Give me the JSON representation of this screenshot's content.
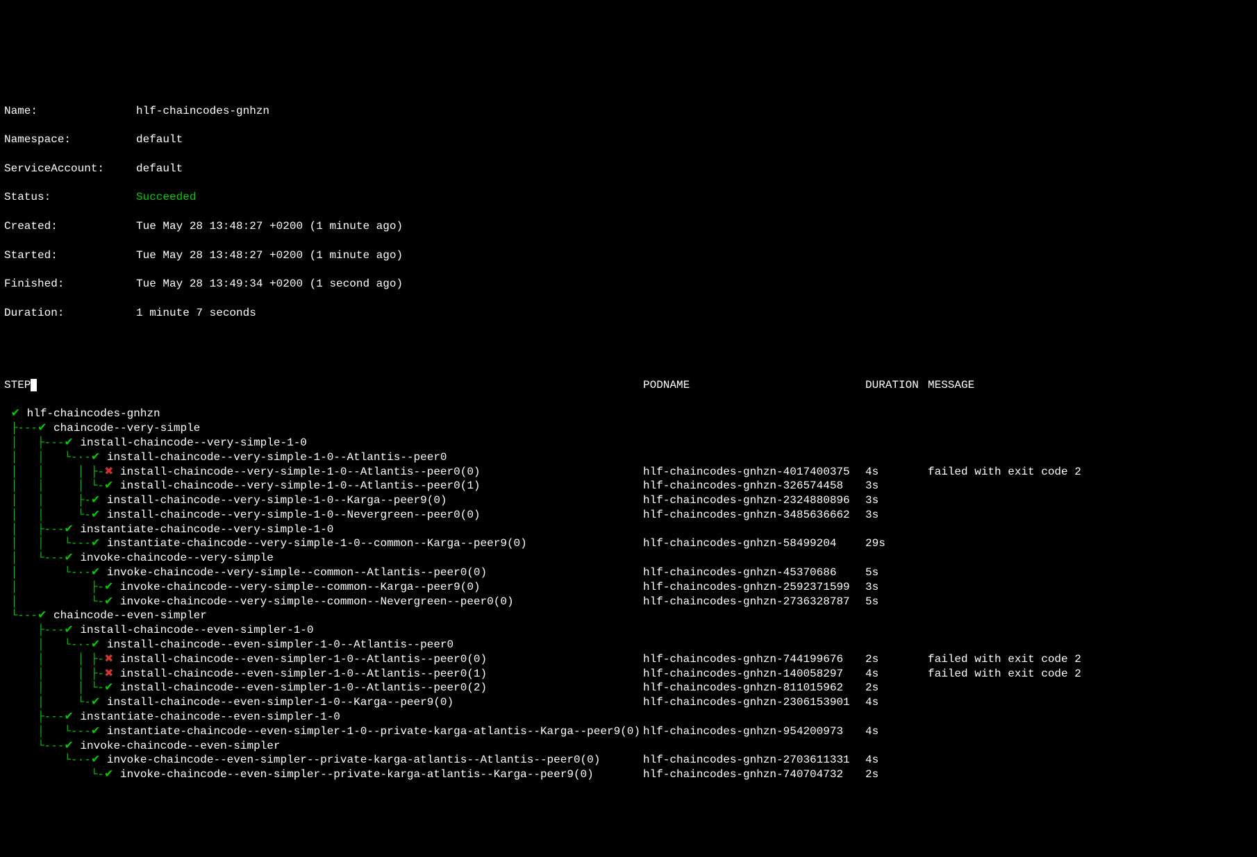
{
  "meta": {
    "name_label": "Name:",
    "name": "hlf-chaincodes-gnhzn",
    "ns_label": "Namespace:",
    "ns": "default",
    "sa_label": "ServiceAccount:",
    "sa": "default",
    "status_label": "Status:",
    "status": "Succeeded",
    "created_label": "Created:",
    "created": "Tue May 28 13:48:27 +0200 (1 minute ago)",
    "started_label": "Started:",
    "started": "Tue May 28 13:48:27 +0200 (1 minute ago)",
    "finished_label": "Finished:",
    "finished": "Tue May 28 13:49:34 +0200 (1 second ago)",
    "duration_label": "Duration:",
    "duration": "1 minute 7 seconds"
  },
  "header": {
    "step": "STEP",
    "podname": "PODNAME",
    "duration": "DURATION",
    "message": "MESSAGE"
  },
  "rows": [
    {
      "prefix_a": " ",
      "icon": "✔",
      "icon_c": "green",
      "prefix_b": " ",
      "step": "hlf-chaincodes-gnhzn",
      "pod": "",
      "dur": "",
      "msg": ""
    },
    {
      "prefix_a": " ├---",
      "icon": "✔",
      "icon_c": "green",
      "prefix_b": " ",
      "step": "chaincode--very-simple",
      "pod": "",
      "dur": "",
      "msg": ""
    },
    {
      "prefix_a": " │   ├---",
      "icon": "✔",
      "icon_c": "green",
      "prefix_b": " ",
      "step": "install-chaincode--very-simple-1-0",
      "pod": "",
      "dur": "",
      "msg": ""
    },
    {
      "prefix_a": " │   │   └-·-",
      "icon": "✔",
      "icon_c": "green",
      "prefix_b": " ",
      "step": "install-chaincode--very-simple-1-0--Atlantis--peer0",
      "pod": "",
      "dur": "",
      "msg": ""
    },
    {
      "prefix_a": " │   │     │ ├-",
      "icon": "✖",
      "icon_c": "red",
      "prefix_b": " ",
      "step": "install-chaincode--very-simple-1-0--Atlantis--peer0(0)",
      "pod": "hlf-chaincodes-gnhzn-4017400375",
      "dur": "4s",
      "msg": "failed with exit code 2"
    },
    {
      "prefix_a": " │   │     │ └-",
      "icon": "✔",
      "icon_c": "green",
      "prefix_b": " ",
      "step": "install-chaincode--very-simple-1-0--Atlantis--peer0(1)",
      "pod": "hlf-chaincodes-gnhzn-326574458",
      "dur": "3s",
      "msg": ""
    },
    {
      "prefix_a": " │   │     ├-",
      "icon": "✔",
      "icon_c": "green",
      "prefix_b": " ",
      "step": "install-chaincode--very-simple-1-0--Karga--peer9(0)",
      "pod": "hlf-chaincodes-gnhzn-2324880896",
      "dur": "3s",
      "msg": ""
    },
    {
      "prefix_a": " │   │     └-",
      "icon": "✔",
      "icon_c": "green",
      "prefix_b": " ",
      "step": "install-chaincode--very-simple-1-0--Nevergreen--peer0(0)",
      "pod": "hlf-chaincodes-gnhzn-3485636662",
      "dur": "3s",
      "msg": ""
    },
    {
      "prefix_a": " │   ├---",
      "icon": "✔",
      "icon_c": "green",
      "prefix_b": " ",
      "step": "instantiate-chaincode--very-simple-1-0",
      "pod": "",
      "dur": "",
      "msg": ""
    },
    {
      "prefix_a": " │   │   └---",
      "icon": "✔",
      "icon_c": "green",
      "prefix_b": " ",
      "step": "instantiate-chaincode--very-simple-1-0--common--Karga--peer9(0)",
      "pod": "hlf-chaincodes-gnhzn-58499204",
      "dur": "29s",
      "msg": ""
    },
    {
      "prefix_a": " │   └---",
      "icon": "✔",
      "icon_c": "green",
      "prefix_b": " ",
      "step": "invoke-chaincode--very-simple",
      "pod": "",
      "dur": "",
      "msg": ""
    },
    {
      "prefix_a": " │       └-·-",
      "icon": "✔",
      "icon_c": "green",
      "prefix_b": " ",
      "step": "invoke-chaincode--very-simple--common--Atlantis--peer0(0)",
      "pod": "hlf-chaincodes-gnhzn-45370686",
      "dur": "5s",
      "msg": ""
    },
    {
      "prefix_a": " │           ├-",
      "icon": "✔",
      "icon_c": "green",
      "prefix_b": " ",
      "step": "invoke-chaincode--very-simple--common--Karga--peer9(0)",
      "pod": "hlf-chaincodes-gnhzn-2592371599",
      "dur": "3s",
      "msg": ""
    },
    {
      "prefix_a": " │           └-",
      "icon": "✔",
      "icon_c": "green",
      "prefix_b": " ",
      "step": "invoke-chaincode--very-simple--common--Nevergreen--peer0(0)",
      "pod": "hlf-chaincodes-gnhzn-2736328787",
      "dur": "5s",
      "msg": ""
    },
    {
      "prefix_a": " └---",
      "icon": "✔",
      "icon_c": "green",
      "prefix_b": " ",
      "step": "chaincode--even-simpler",
      "pod": "",
      "dur": "",
      "msg": ""
    },
    {
      "prefix_a": "     ├---",
      "icon": "✔",
      "icon_c": "green",
      "prefix_b": " ",
      "step": "install-chaincode--even-simpler-1-0",
      "pod": "",
      "dur": "",
      "msg": ""
    },
    {
      "prefix_a": "     │   └-·-",
      "icon": "✔",
      "icon_c": "green",
      "prefix_b": " ",
      "step": "install-chaincode--even-simpler-1-0--Atlantis--peer0",
      "pod": "",
      "dur": "",
      "msg": ""
    },
    {
      "prefix_a": "     │     │ ├-",
      "icon": "✖",
      "icon_c": "red",
      "prefix_b": " ",
      "step": "install-chaincode--even-simpler-1-0--Atlantis--peer0(0)",
      "pod": "hlf-chaincodes-gnhzn-744199676",
      "dur": "2s",
      "msg": "failed with exit code 2"
    },
    {
      "prefix_a": "     │     │ ├-",
      "icon": "✖",
      "icon_c": "red",
      "prefix_b": " ",
      "step": "install-chaincode--even-simpler-1-0--Atlantis--peer0(1)",
      "pod": "hlf-chaincodes-gnhzn-140058297",
      "dur": "4s",
      "msg": "failed with exit code 2"
    },
    {
      "prefix_a": "     │     │ └-",
      "icon": "✔",
      "icon_c": "green",
      "prefix_b": " ",
      "step": "install-chaincode--even-simpler-1-0--Atlantis--peer0(2)",
      "pod": "hlf-chaincodes-gnhzn-811015962",
      "dur": "2s",
      "msg": ""
    },
    {
      "prefix_a": "     │     └-",
      "icon": "✔",
      "icon_c": "green",
      "prefix_b": " ",
      "step": "install-chaincode--even-simpler-1-0--Karga--peer9(0)",
      "pod": "hlf-chaincodes-gnhzn-2306153901",
      "dur": "4s",
      "msg": ""
    },
    {
      "prefix_a": "     ├---",
      "icon": "✔",
      "icon_c": "green",
      "prefix_b": " ",
      "step": "instantiate-chaincode--even-simpler-1-0",
      "pod": "",
      "dur": "",
      "msg": ""
    },
    {
      "prefix_a": "     │   └---",
      "icon": "✔",
      "icon_c": "green",
      "prefix_b": " ",
      "step": "instantiate-chaincode--even-simpler-1-0--private-karga-atlantis--Karga--peer9(0)",
      "pod": "hlf-chaincodes-gnhzn-954200973",
      "dur": "4s",
      "msg": ""
    },
    {
      "prefix_a": "     └---",
      "icon": "✔",
      "icon_c": "green",
      "prefix_b": " ",
      "step": "invoke-chaincode--even-simpler",
      "pod": "",
      "dur": "",
      "msg": ""
    },
    {
      "prefix_a": "         └-·-",
      "icon": "✔",
      "icon_c": "green",
      "prefix_b": " ",
      "step": "invoke-chaincode--even-simpler--private-karga-atlantis--Atlantis--peer0(0)",
      "pod": "hlf-chaincodes-gnhzn-2703611331",
      "dur": "4s",
      "msg": ""
    },
    {
      "prefix_a": "             └-",
      "icon": "✔",
      "icon_c": "green",
      "prefix_b": " ",
      "step": "invoke-chaincode--even-simpler--private-karga-atlantis--Karga--peer9(0)",
      "pod": "hlf-chaincodes-gnhzn-740704732",
      "dur": "2s",
      "msg": ""
    }
  ]
}
